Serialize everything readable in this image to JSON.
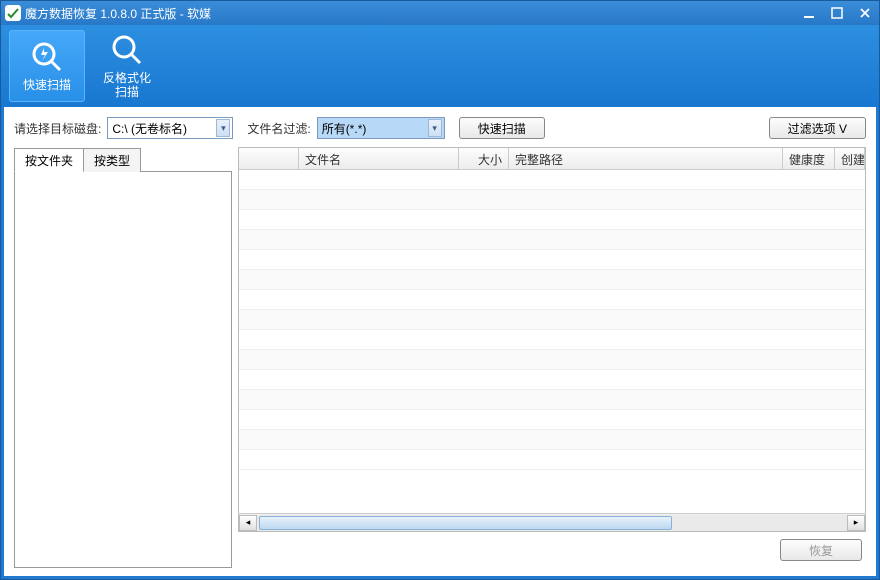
{
  "title": "魔方数据恢复 1.0.8.0 正式版 - 软媒",
  "ribbon": {
    "quick_scan": "快速扫描",
    "format_scan": "反格式化\n扫描"
  },
  "filter": {
    "disk_label": "请选择目标磁盘:",
    "disk_value": "C:\\ (无卷标名)",
    "name_filter_label": "文件名过滤:",
    "name_filter_value": "所有(*.*)",
    "scan_btn": "快速扫描",
    "options_btn": "过滤选项   V"
  },
  "tabs": {
    "by_folder": "按文件夹",
    "by_type": "按类型"
  },
  "columns": {
    "checkbox": "",
    "name": "文件名",
    "size": "大小",
    "path": "完整路径",
    "health": "健康度",
    "created": "创建"
  },
  "footer": {
    "recover": "恢复"
  }
}
